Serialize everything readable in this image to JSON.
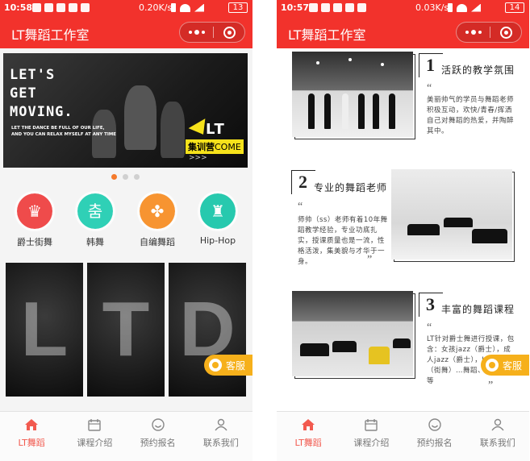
{
  "screens": [
    {
      "status": {
        "time": "10:58",
        "speed": "0.20",
        "speed_unit": "K/s",
        "battery": "13"
      },
      "header": {
        "title": "LT舞蹈工作室"
      },
      "banner": {
        "lines": [
          "LET'S",
          "GET",
          "MOVING."
        ],
        "sub": "LET THE DANCE BE FULL OF OUR LIFE, AND YOU CAN RELAX MYSELF AT ANY TIME",
        "lt": "LT",
        "tag_cn": "集训营",
        "tag_en": "COME",
        "arrows": ">>>"
      },
      "categories": [
        {
          "label": "爵士街舞",
          "color": "#ef4b4b",
          "glyph": "♛"
        },
        {
          "label": "韩舞",
          "color": "#2fd0b6",
          "glyph": "춤"
        },
        {
          "label": "自编舞蹈",
          "color": "#f79431",
          "glyph": "✤"
        },
        {
          "label": "Hip-Hop",
          "color": "#27c9ae",
          "glyph": "♜"
        }
      ],
      "cards": [
        "L",
        "T",
        "D"
      ],
      "kefu": "客服"
    },
    {
      "status": {
        "time": "10:57",
        "speed": "0.03",
        "speed_unit": "K/s",
        "battery": "14"
      },
      "header": {
        "title": "LT舞蹈工作室"
      },
      "sections": [
        {
          "num": "1",
          "title": "活跃的教学氛围",
          "desc": "美丽帅气的学员与舞蹈老师积极互动，欢快/青春/挥洒自己对舞蹈的热爱，并陶醉其中。"
        },
        {
          "num": "2",
          "title": "专业的舞蹈老师",
          "desc": "师帅（ss）老师有着10年舞蹈教学经验，专业功底扎实，授课质量也是一流，性格活泼，集美貌与才华于一身。"
        },
        {
          "num": "3",
          "title": "丰富的舞蹈课程",
          "desc": "LT针对爵士舞进行授课，包含：女孩jazz（爵士），成人jazz（爵士），Hip-Hop（街舞）…舞蹈、自编舞蹈等"
        }
      ],
      "kefu": "客服"
    }
  ],
  "tabs": [
    {
      "label": "LT舞蹈",
      "icon": "home-icon"
    },
    {
      "label": "课程介绍",
      "icon": "calendar-icon"
    },
    {
      "label": "预约报名",
      "icon": "smile-icon"
    },
    {
      "label": "联系我们",
      "icon": "user-icon"
    }
  ],
  "quotes": {
    "open": "“",
    "close": "”"
  },
  "colors": {
    "header": "#f2322c",
    "active_tab": "#f25a4f",
    "kefu": "#f6b01b"
  }
}
